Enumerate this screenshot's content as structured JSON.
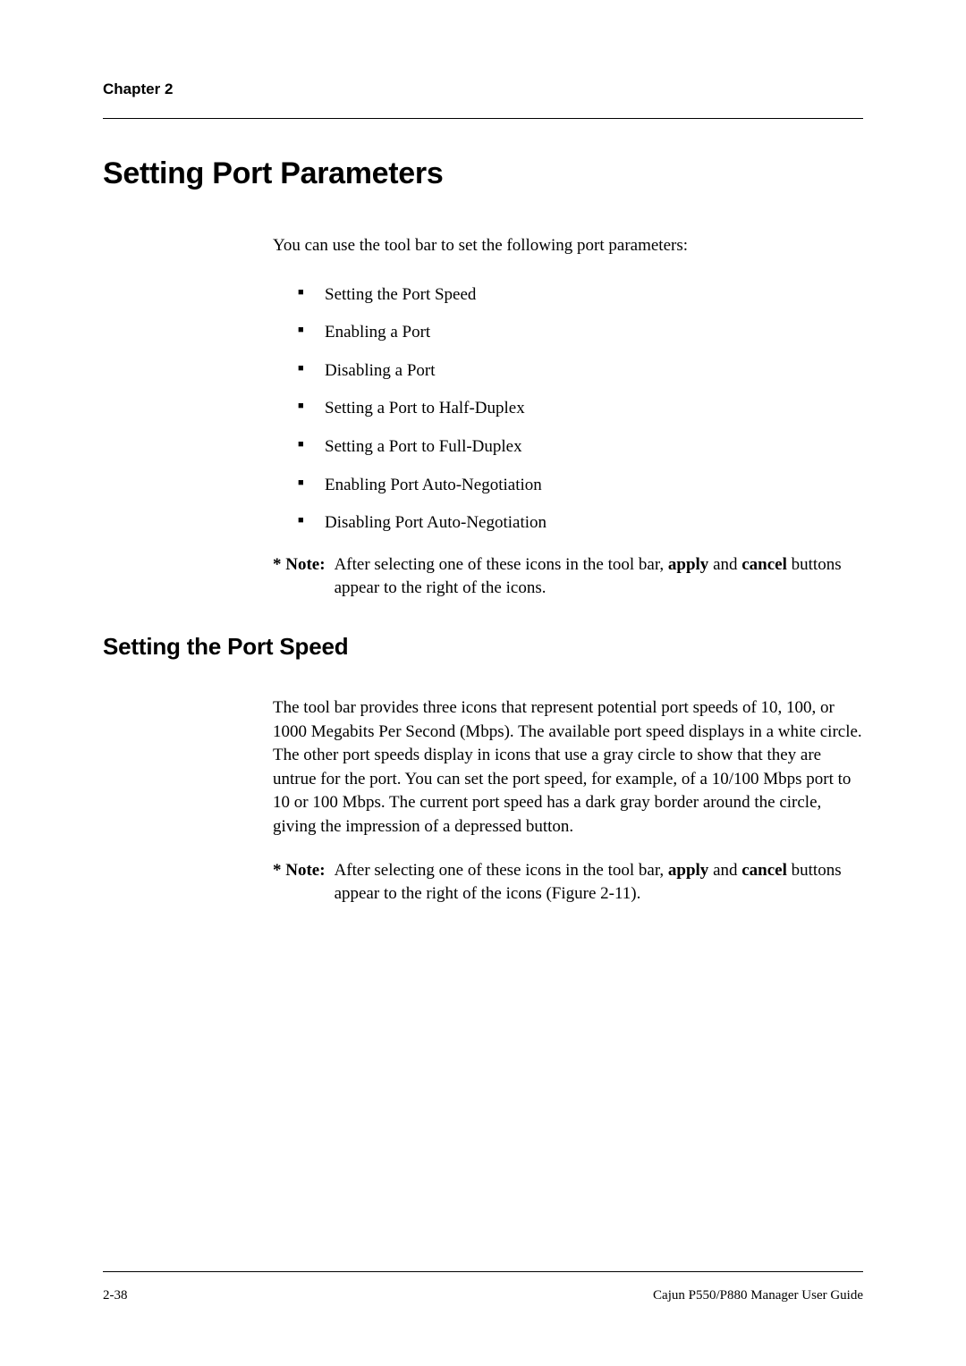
{
  "header": {
    "chapter_label": "Chapter 2"
  },
  "section": {
    "title": "Setting Port Parameters",
    "intro": "You can use the tool bar to set the following port parameters:",
    "bullets": [
      "Setting the Port Speed",
      "Enabling a Port",
      "Disabling a Port",
      "Setting a Port to Half-Duplex",
      "Setting a Port to Full-Duplex",
      "Enabling Port Auto-Negotiation",
      "Disabling Port Auto-Negotiation"
    ],
    "note1": {
      "label": "* Note:",
      "text_before_apply": "After selecting one of these icons in the tool bar, ",
      "apply": "apply",
      "text_mid": " and ",
      "cancel": "cancel",
      "text_after": " buttons appear to the right of the icons."
    }
  },
  "subsection": {
    "title": "Setting the Port Speed",
    "para": "The tool bar provides three icons that represent potential port speeds of 10, 100, or 1000 Megabits Per Second (Mbps). The available port speed displays in a white circle. The other port speeds display in icons that use a gray circle to show that they are untrue for the port. You can set the port speed, for example, of a 10/100 Mbps port to 10 or 100 Mbps. The current port speed has a dark gray border around the circle, giving the impression of a depressed button.",
    "note2": {
      "label": "* Note:",
      "text_before_apply": "After selecting one of these icons in the tool bar, ",
      "apply": "apply",
      "text_mid": " and ",
      "cancel": "cancel",
      "text_after": " buttons appear to the right of the icons (Figure 2-11)."
    }
  },
  "footer": {
    "page_number": "2-38",
    "guide_title": "Cajun P550/P880 Manager User Guide"
  }
}
